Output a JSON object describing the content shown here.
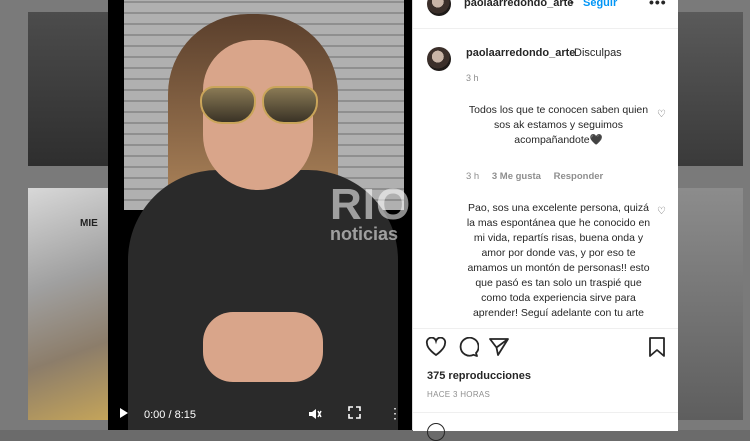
{
  "background": {
    "tile_label": "MIE"
  },
  "video": {
    "time": "0:00 / 8:15",
    "watermark_big": "RIO",
    "watermark_small": "noticias",
    "icons": [
      "play-icon",
      "mute-icon",
      "fullscreen-icon",
      "more-vertical-icon"
    ]
  },
  "post": {
    "username": "paolaarredondo_arte",
    "separator": "•",
    "follow_label": "Seguir",
    "more": "•••"
  },
  "caption": {
    "username": "paolaarredondo_arte",
    "text": "Disculpas",
    "time": "3 h"
  },
  "comments": [
    {
      "text": "Todos los que te conocen saben quien sos ak estamos y seguimos acompañandote🖤",
      "time": "3 h",
      "likes": "3 Me gusta",
      "reply": "Responder"
    },
    {
      "text": "Pao, sos una excelente persona, quizá la mas espontánea que he conocido en mi vida, repartís risas, buena onda y amor por donde vas, y por eso te amamos un montón de personas!! esto que pasó es tan solo un traspié que como toda experiencia sirve para aprender! Seguí adelante con tu arte"
    }
  ],
  "actions": {
    "views": "375 reproducciones",
    "posted_ago": "HACE 3 HORAS",
    "icons": [
      "heart-icon",
      "comment-icon",
      "share-icon",
      "bookmark-icon"
    ]
  },
  "colors": {
    "link_blue": "#0095f6",
    "text": "#262626",
    "muted": "#8e8e8e"
  }
}
